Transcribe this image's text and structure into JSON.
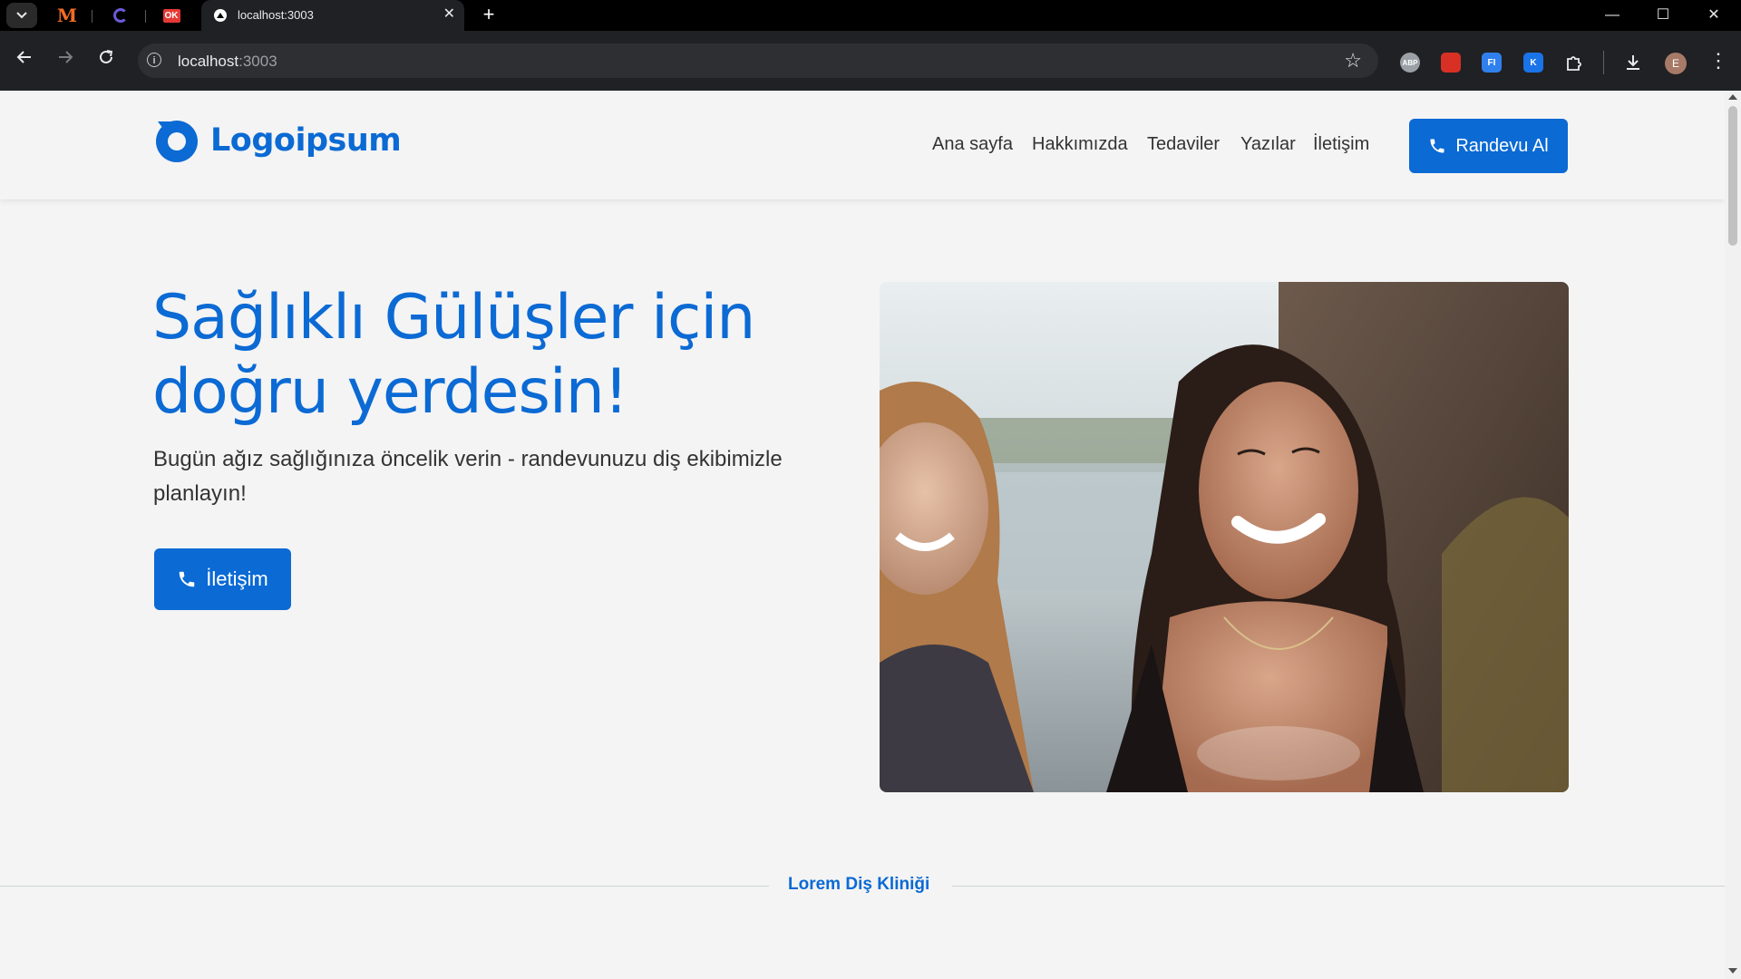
{
  "browser": {
    "tab_title": "localhost:3003",
    "pinned_tabs": [
      {
        "icon": "m-logo-icon",
        "label": "M"
      },
      {
        "icon": "c-logo-icon",
        "label": ""
      },
      {
        "icon": "ok-logo-icon",
        "label": "OK"
      }
    ],
    "url_host": "localhost",
    "url_port": ":3003",
    "extensions": [
      {
        "name": "abp-extension",
        "label": "ABP",
        "color": "#9aa0a6"
      },
      {
        "name": "red-extension",
        "label": "",
        "color": "#d93025"
      },
      {
        "name": "fi-extension",
        "label": "FI",
        "color": "#2f80ed"
      },
      {
        "name": "k-extension",
        "label": "K",
        "color": "#1a73e8"
      }
    ],
    "profile_initial": "E"
  },
  "site": {
    "logo_text": "Logoipsum",
    "brand_color": "#0b6ad4",
    "nav": [
      {
        "label": "Ana sayfa"
      },
      {
        "label": "Hakkımızda"
      },
      {
        "label": "Tedaviler"
      },
      {
        "label": "Yazılar"
      },
      {
        "label": "İletişim"
      }
    ],
    "cta_label": "Randevu Al"
  },
  "hero": {
    "title": "Sağlıklı Gülüşler için doğru yerdesin!",
    "subtitle": "Bugün ağız sağlığınıza öncelik verin - randevunuzu diş ekibimizle planlayın!",
    "button_label": "İletişim",
    "image_alt": "two smiling women"
  },
  "section": {
    "divider_label": "Lorem Diş Kliniği"
  }
}
